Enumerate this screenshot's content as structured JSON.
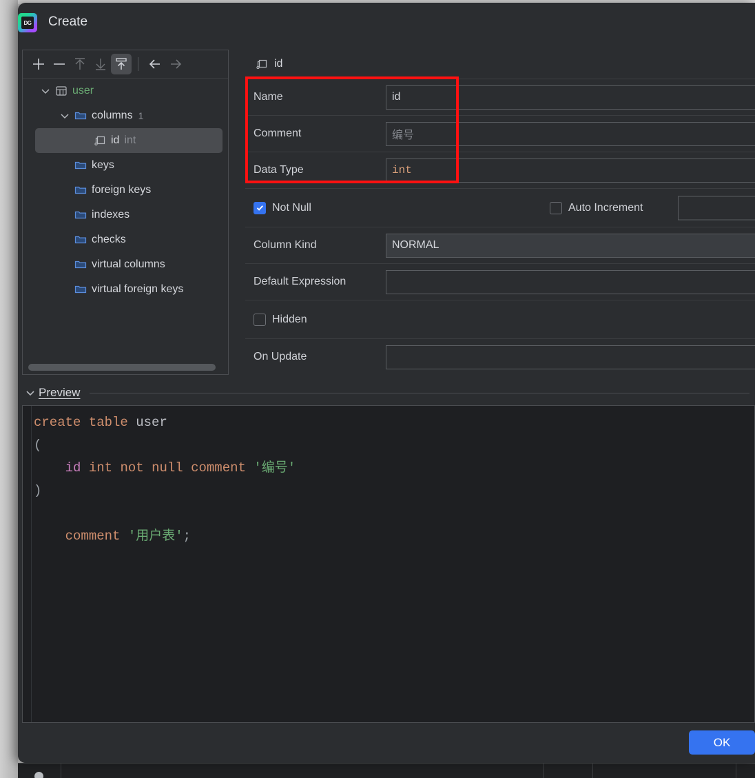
{
  "window": {
    "title": "Create",
    "app_icon": "datagrip-icon",
    "icon_text": "DG"
  },
  "toolbar": {
    "buttons": [
      {
        "name": "add-button",
        "icon": "plus-icon",
        "state": "enabled"
      },
      {
        "name": "remove-button",
        "icon": "minus-icon",
        "state": "enabled"
      },
      {
        "name": "move-up-button",
        "icon": "arrow-up-icon",
        "state": "disabled"
      },
      {
        "name": "move-down-button",
        "icon": "arrow-down-icon",
        "state": "disabled"
      },
      {
        "name": "toggle-panel-button",
        "icon": "panel-up-icon",
        "state": "active"
      },
      {
        "name": "back-button",
        "icon": "arrow-left-icon",
        "state": "enabled"
      },
      {
        "name": "forward-button",
        "icon": "arrow-right-icon",
        "state": "disabled"
      }
    ]
  },
  "tree": {
    "nodes": [
      {
        "label": "user",
        "icon": "table-icon",
        "indent": 0,
        "expanded": true,
        "color": "green",
        "count": "",
        "type": ""
      },
      {
        "label": "columns",
        "icon": "folder-icon",
        "indent": 1,
        "expanded": true,
        "color": "plain",
        "count": "1",
        "type": ""
      },
      {
        "label": "id",
        "icon": "column-icon",
        "indent": 2,
        "expanded": null,
        "color": "plain",
        "count": "",
        "type": "int",
        "selected": true
      },
      {
        "label": "keys",
        "icon": "folder-icon",
        "indent": 1,
        "expanded": null,
        "color": "plain",
        "count": "",
        "type": ""
      },
      {
        "label": "foreign keys",
        "icon": "folder-icon",
        "indent": 1,
        "expanded": null,
        "color": "plain",
        "count": "",
        "type": ""
      },
      {
        "label": "indexes",
        "icon": "folder-icon",
        "indent": 1,
        "expanded": null,
        "color": "plain",
        "count": "",
        "type": ""
      },
      {
        "label": "checks",
        "icon": "folder-icon",
        "indent": 1,
        "expanded": null,
        "color": "plain",
        "count": "",
        "type": ""
      },
      {
        "label": "virtual columns",
        "icon": "folder-icon",
        "indent": 1,
        "expanded": null,
        "color": "plain",
        "count": "",
        "type": ""
      },
      {
        "label": "virtual foreign keys",
        "icon": "folder-icon",
        "indent": 1,
        "expanded": null,
        "color": "plain",
        "count": "",
        "type": ""
      }
    ]
  },
  "detail": {
    "header_title": "id",
    "header_icon": "column-icon",
    "fields": {
      "name_label": "Name",
      "name_value": "id",
      "comment_label": "Comment",
      "comment_value": "编号",
      "data_type_label": "Data Type",
      "data_type_value": "int",
      "not_null_label": "Not Null",
      "not_null_checked": true,
      "auto_increment_label": "Auto Increment",
      "auto_increment_checked": false,
      "column_kind_label": "Column Kind",
      "column_kind_value": "NORMAL",
      "default_expression_label": "Default Expression",
      "default_expression_value": "",
      "hidden_label": "Hidden",
      "hidden_checked": false,
      "on_update_label": "On Update",
      "on_update_value": ""
    }
  },
  "annotation": {
    "highlight_color": "#ff1111",
    "target": "name-comment-datatype-fields"
  },
  "preview": {
    "title": "Preview",
    "expanded": true,
    "sql_lines": [
      {
        "tokens": [
          {
            "t": "create",
            "c": "k"
          },
          {
            "t": " ",
            "c": "pn"
          },
          {
            "t": "table",
            "c": "k"
          },
          {
            "t": " ",
            "c": "pn"
          },
          {
            "t": "user",
            "c": "tb"
          }
        ]
      },
      {
        "tokens": [
          {
            "t": "(",
            "c": "pn"
          }
        ]
      },
      {
        "tokens": [
          {
            "t": "    ",
            "c": "pn"
          },
          {
            "t": "id",
            "c": "id"
          },
          {
            "t": " ",
            "c": "pn"
          },
          {
            "t": "int",
            "c": "k"
          },
          {
            "t": " ",
            "c": "pn"
          },
          {
            "t": "not",
            "c": "k"
          },
          {
            "t": " ",
            "c": "pn"
          },
          {
            "t": "null",
            "c": "k"
          },
          {
            "t": " ",
            "c": "pn"
          },
          {
            "t": "comment",
            "c": "k"
          },
          {
            "t": " ",
            "c": "pn"
          },
          {
            "t": "'编号'",
            "c": "st"
          }
        ]
      },
      {
        "tokens": [
          {
            "t": ")",
            "c": "pn"
          }
        ]
      },
      {
        "tokens": [
          {
            "t": "",
            "c": "pn"
          }
        ]
      },
      {
        "tokens": [
          {
            "t": "    ",
            "c": "pn"
          },
          {
            "t": "comment",
            "c": "k"
          },
          {
            "t": " ",
            "c": "pn"
          },
          {
            "t": "'用户表'",
            "c": "st"
          },
          {
            "t": ";",
            "c": "pn"
          }
        ]
      }
    ]
  },
  "footer": {
    "ok_label": "OK",
    "ok_color": "#3573f0"
  }
}
